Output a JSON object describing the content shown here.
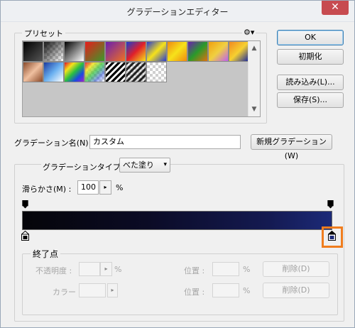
{
  "window": {
    "title": "グラデーションエディター",
    "close_glyph": "✕"
  },
  "presets": {
    "label": "プリセット",
    "menu_glyph": "⚙▾",
    "scroll_up": "▲",
    "scroll_down": "▼"
  },
  "buttons": {
    "ok": "OK",
    "reset": "初期化",
    "load": "読み込み(L)...",
    "save": "保存(S)...",
    "new": "新規グラデーション(W)"
  },
  "name_row": {
    "label": "グラデーション名(N) :",
    "value": "カスタム"
  },
  "type_row": {
    "label": "グラデーションタイプ(T) :",
    "value": "べた塗り",
    "arrow": "▾"
  },
  "smoothness": {
    "label": "滑らかさ(M) :",
    "value": "100",
    "arrow": "▸",
    "unit": "%"
  },
  "stops_group": {
    "label": "終了点",
    "opacity_label": "不透明度 :",
    "opacity_arrow": "▸",
    "percent": "%",
    "color_label": "カラー :",
    "color_arrow": "▸",
    "location_label": "位置 :",
    "delete_label": "削除(D)"
  }
}
